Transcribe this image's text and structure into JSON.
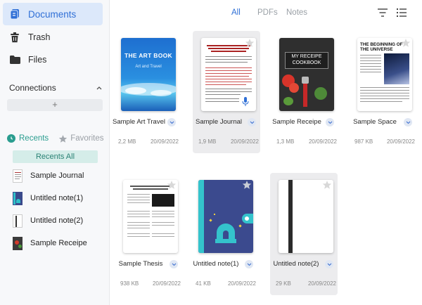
{
  "sidebar": {
    "nav": [
      {
        "label": "Documents",
        "icon": "documents-icon",
        "active": true
      },
      {
        "label": "Trash",
        "icon": "trash-icon",
        "active": false
      },
      {
        "label": "Files",
        "icon": "folder-icon",
        "active": false
      }
    ],
    "connections_label": "Connections",
    "add_symbol": "+",
    "recents_label": "Recents",
    "favorites_label": "Favorites",
    "recents_all_label": "Recents All",
    "recent_items": [
      {
        "name": "Sample Journal"
      },
      {
        "name": "Untitled note(1)"
      },
      {
        "name": "Untitled note(2)"
      },
      {
        "name": "Sample Receipe"
      }
    ]
  },
  "header": {
    "filters": [
      "All",
      "PDFs",
      "Notes"
    ],
    "active_filter": "All"
  },
  "documents": [
    {
      "name": "Sample Art Travel",
      "size": "2,2 MB",
      "date": "20/09/2022",
      "cover_title": "THE ART BOOK",
      "cover_subtitle": "Art and Travel"
    },
    {
      "name": "Sample Journal",
      "size": "1,9 MB",
      "date": "20/09/2022",
      "selected": true
    },
    {
      "name": "Sample Receipe",
      "size": "1,3 MB",
      "date": "20/09/2022",
      "cover_title": "MY RECEIPE COOKBOOK"
    },
    {
      "name": "Sample Space",
      "size": "987 KB",
      "date": "20/09/2022",
      "cover_title": "THE BEGINNING OF THE UNIVERSE"
    },
    {
      "name": "Sample Thesis",
      "size": "938 KB",
      "date": "20/09/2022"
    },
    {
      "name": "Untitled note(1)",
      "size": "41 KB",
      "date": "20/09/2022"
    },
    {
      "name": "Untitled note(2)",
      "size": "29 KB",
      "date": "20/09/2022",
      "selected": true
    }
  ],
  "colors": {
    "accent": "#2f6fd6",
    "teal": "#2a9d8f",
    "selected_bg": "#ececee",
    "active_nav_bg": "#dce8fa"
  }
}
